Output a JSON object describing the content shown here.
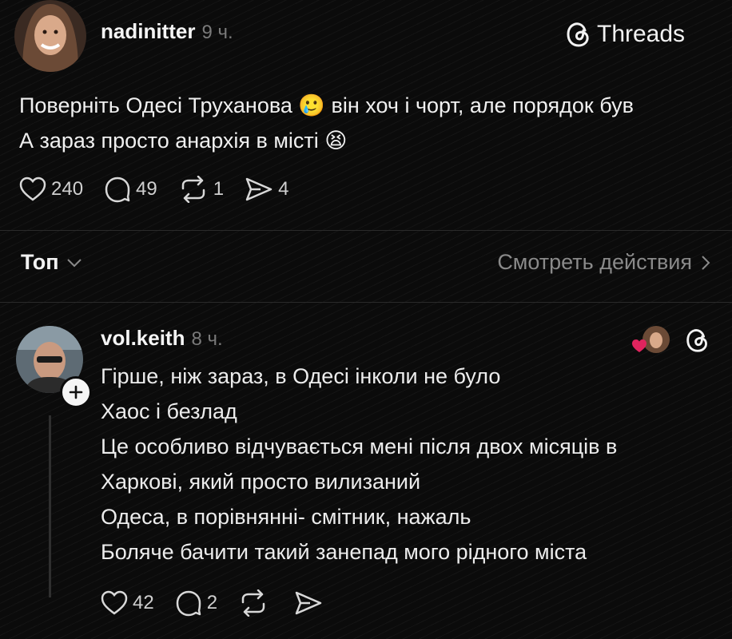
{
  "brand": {
    "label": "Threads"
  },
  "post": {
    "username": "nadinitter",
    "time": "9 ч.",
    "lines": [
      "Поверніть Одесі Труханова 🥲 він хоч і чорт, але порядок був",
      "А зараз просто анархія в місті 😫"
    ],
    "likes": "240",
    "comments": "49",
    "reposts": "1",
    "shares": "4"
  },
  "sort": {
    "label": "Топ",
    "view_activity": "Смотреть действия"
  },
  "reply": {
    "username": "vol.keith",
    "time": "8 ч.",
    "lines": [
      "Гірше, ніж зараз, в Одесі інколи не було",
      "Хаос і безлад",
      "Це особливо відчувається мені після двох місяців в",
      "Харкові, який просто вилизаний",
      "Одеса, в порівнянні- смітник, нажаль",
      "Боляче бачити такий занепад мого рідного міста"
    ],
    "likes": "42",
    "comments": "2"
  },
  "colors": {
    "background": "#0b0b0b",
    "text": "#f2f2f2",
    "muted": "#7a7a7a",
    "heart": "#e0245e"
  },
  "icons": [
    "threads-logo-icon",
    "heart-icon",
    "comment-icon",
    "repost-icon",
    "share-icon",
    "chevron-down-icon",
    "chevron-right-icon",
    "plus-icon"
  ]
}
